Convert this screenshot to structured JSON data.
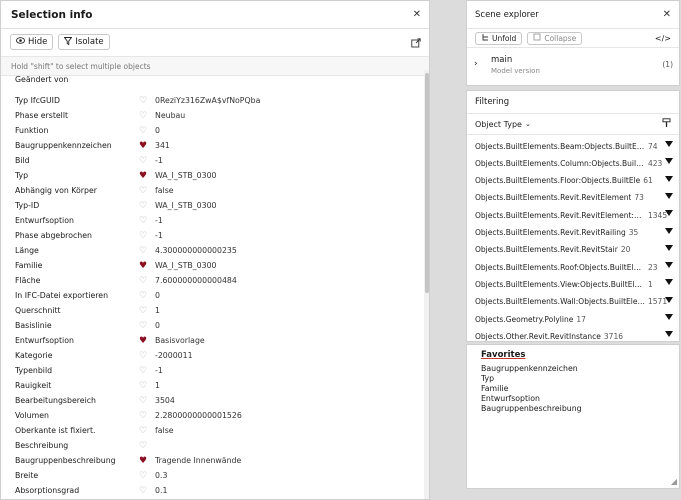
{
  "selection_panel": {
    "title": "Selection info",
    "hide_label": "Hide",
    "isolate_label": "Isolate",
    "hint": "Hold \"shift\" to select multiple objects",
    "properties": [
      {
        "name": "Geändert von",
        "heart": false,
        "value": ""
      },
      {
        "name": "Typ IfcGUID",
        "heart": false,
        "value": "0ReziYz316ZwA$vfNoPQba"
      },
      {
        "name": "Phase erstellt",
        "heart": false,
        "value": "Neubau"
      },
      {
        "name": "Funktion",
        "heart": false,
        "value": "0"
      },
      {
        "name": "Baugruppenkennzeichen",
        "heart": true,
        "value": "341"
      },
      {
        "name": "Bild",
        "heart": false,
        "value": "-1"
      },
      {
        "name": "Typ",
        "heart": true,
        "value": "WA_I_STB_0300"
      },
      {
        "name": "Abhängig von Körper",
        "heart": false,
        "value": "false"
      },
      {
        "name": "Typ-ID",
        "heart": false,
        "value": "WA_I_STB_0300"
      },
      {
        "name": "Entwurfsoption",
        "heart": false,
        "value": "-1"
      },
      {
        "name": "Phase abgebrochen",
        "heart": false,
        "value": "-1"
      },
      {
        "name": "Länge",
        "heart": false,
        "value": "4.300000000000235"
      },
      {
        "name": "Familie",
        "heart": true,
        "value": "WA_I_STB_0300"
      },
      {
        "name": "Fläche",
        "heart": false,
        "value": "7.600000000000484"
      },
      {
        "name": "In IFC-Datei exportieren",
        "heart": false,
        "value": "0"
      },
      {
        "name": "Querschnitt",
        "heart": false,
        "value": "1"
      },
      {
        "name": "Basislinie",
        "heart": false,
        "value": "0"
      },
      {
        "name": "Entwurfsoption",
        "heart": true,
        "value": "Basisvorlage"
      },
      {
        "name": "Kategorie",
        "heart": false,
        "value": "-2000011"
      },
      {
        "name": "Typenbild",
        "heart": false,
        "value": "-1"
      },
      {
        "name": "Rauigkeit",
        "heart": false,
        "value": "1"
      },
      {
        "name": "Bearbeitungsbereich",
        "heart": false,
        "value": "3504"
      },
      {
        "name": "Volumen",
        "heart": false,
        "value": "2.2800000000001526"
      },
      {
        "name": "Oberkante ist fixiert.",
        "heart": false,
        "value": "false"
      },
      {
        "name": "Beschreibung",
        "heart": false,
        "value": ""
      },
      {
        "name": "Baugruppenbeschreibung",
        "heart": true,
        "value": "Tragende Innenwände"
      },
      {
        "name": "Breite",
        "heart": false,
        "value": "0.3"
      },
      {
        "name": "Absorptionsgrad",
        "heart": false,
        "value": "0.1"
      }
    ]
  },
  "scene_explorer": {
    "title": "Scene explorer",
    "unfold_label": "Unfold",
    "collapse_label": "Collapse",
    "model_name": "main",
    "model_sub": "Model version",
    "model_count": "(1)"
  },
  "filtering": {
    "title": "Filtering",
    "selector_label": "Object Type",
    "items": [
      {
        "text": "Objects.BuiltElements.Beam:Objects.BuiltElements.Revit.RevitBeam",
        "count": "74"
      },
      {
        "text": "Objects.BuiltElements.Column:Objects.BuiltElements.Revit.RevitColumn",
        "count": "423"
      },
      {
        "text": "Objects.BuiltElements.Floor:Objects.BuiltEle",
        "count": "61"
      },
      {
        "text": "Objects.BuiltElements.Revit.RevitElement",
        "count": "73"
      },
      {
        "text": "Objects.BuiltElements.Revit.RevitElement:Objects.BuiltElements",
        "count": "1345"
      },
      {
        "text": "Objects.BuiltElements.Revit.RevitRailing",
        "count": "35"
      },
      {
        "text": "Objects.BuiltElements.Revit.RevitStair",
        "count": "20"
      },
      {
        "text": "Objects.BuiltElements.Roof:Objects.BuiltElements.Revit.RevitRoof",
        "count": "23"
      },
      {
        "text": "Objects.BuiltElements.View:Objects.BuiltElements.Revit.RevitView",
        "count": "1"
      },
      {
        "text": "Objects.BuiltElements.Wall:Objects.BuiltElements.Revit.RevitWall",
        "count": "1571"
      },
      {
        "text": "Objects.Geometry.Polyline",
        "count": "17"
      },
      {
        "text": "Objects.Other.Revit.RevitInstance",
        "count": "3716"
      }
    ]
  },
  "favorites": {
    "title": "Favorites",
    "items": [
      "Baugruppenkennzeichen",
      "Typ",
      "Familie",
      "Entwurfsoption",
      "Baugruppenbeschreibung"
    ]
  },
  "colors": {
    "heart_active": "#8b1022",
    "heart_inactive": "#a0a0a0",
    "accent_underline": "#c0392b"
  }
}
